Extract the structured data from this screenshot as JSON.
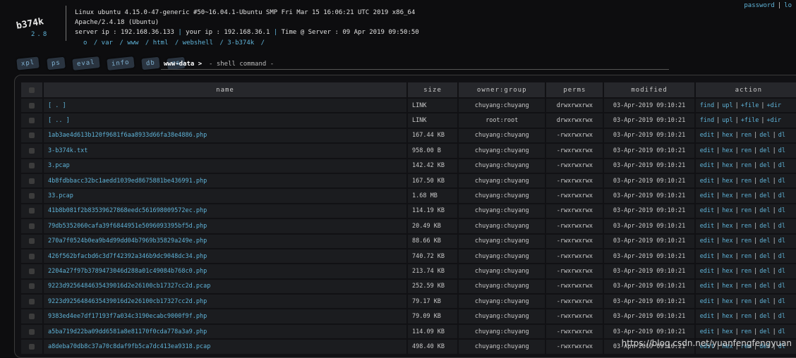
{
  "logo": {
    "name": "b374k",
    "version": "2.8"
  },
  "sysinfo": {
    "kernel": "Linux ubuntu 4.15.0-47-generic #50~16.04.1-Ubuntu SMP Fri Mar 15 16:06:21 UTC 2019 x86_64",
    "server_software": "Apache/2.4.18 (Ubuntu)",
    "server_ip": "server ip : 192.168.36.133",
    "your_ip": "your ip : 192.168.36.1",
    "time": "Time @ Server : 09 Apr 2019 09:50:50"
  },
  "path": [
    "o",
    "/ var",
    "/ www",
    "/ html",
    "/ webshell",
    "/ 3-b374k",
    "/"
  ],
  "top_links": {
    "password": "password",
    "logout": "lo"
  },
  "tabs": [
    "xpl",
    "ps",
    "eval",
    "info",
    "db",
    "rs"
  ],
  "user": "www-data >",
  "shell_label": "- shell command -",
  "columns": [
    "name",
    "size",
    "owner:group",
    "perms",
    "modified",
    "action"
  ],
  "files": [
    {
      "name": "[ . ]",
      "size": "LINK",
      "owner": "chuyang:chuyang",
      "perms": "drwxrwxrwx",
      "modified": "03-Apr-2019 09:10:21",
      "actions": [
        "find",
        "upl",
        "+file",
        "+dir"
      ]
    },
    {
      "name": "[ .. ]",
      "size": "LINK",
      "owner": "root:root",
      "perms": "drwxrwxrwx",
      "modified": "03-Apr-2019 09:10:21",
      "actions": [
        "find",
        "upl",
        "+file",
        "+dir"
      ]
    },
    {
      "name": "1ab3ae4d613b120f9681f6aa8933d66fa38e4886.php",
      "size": "167.44 KB",
      "owner": "chuyang:chuyang",
      "perms": "-rwxrwxrwx",
      "modified": "03-Apr-2019 09:10:21",
      "actions": [
        "edit",
        "hex",
        "ren",
        "del",
        "dl"
      ]
    },
    {
      "name": "3-b374k.txt",
      "size": "958.00 B",
      "owner": "chuyang:chuyang",
      "perms": "-rwxrwxrwx",
      "modified": "03-Apr-2019 09:10:21",
      "actions": [
        "edit",
        "hex",
        "ren",
        "del",
        "dl"
      ]
    },
    {
      "name": "3.pcap",
      "size": "142.42 KB",
      "owner": "chuyang:chuyang",
      "perms": "-rwxrwxrwx",
      "modified": "03-Apr-2019 09:10:21",
      "actions": [
        "edit",
        "hex",
        "ren",
        "del",
        "dl"
      ]
    },
    {
      "name": "4b8fdbbacc32bc1aedd1039ed8675881be436991.php",
      "size": "167.50 KB",
      "owner": "chuyang:chuyang",
      "perms": "-rwxrwxrwx",
      "modified": "03-Apr-2019 09:10:21",
      "actions": [
        "edit",
        "hex",
        "ren",
        "del",
        "dl"
      ]
    },
    {
      "name": "33.pcap",
      "size": "1.68 MB",
      "owner": "chuyang:chuyang",
      "perms": "-rwxrwxrwx",
      "modified": "03-Apr-2019 09:10:21",
      "actions": [
        "edit",
        "hex",
        "ren",
        "del",
        "dl"
      ]
    },
    {
      "name": "41b8b081f2b83539627868eedc561698009572ec.php",
      "size": "114.19 KB",
      "owner": "chuyang:chuyang",
      "perms": "-rwxrwxrwx",
      "modified": "03-Apr-2019 09:10:21",
      "actions": [
        "edit",
        "hex",
        "ren",
        "del",
        "dl"
      ]
    },
    {
      "name": "79db5352060cafa39f6844951e5096093395bf5d.php",
      "size": "20.49 KB",
      "owner": "chuyang:chuyang",
      "perms": "-rwxrwxrwx",
      "modified": "03-Apr-2019 09:10:21",
      "actions": [
        "edit",
        "hex",
        "ren",
        "del",
        "dl"
      ]
    },
    {
      "name": "270a7f0524b0ea9b4d99dd04b7969b35829a249e.php",
      "size": "88.66 KB",
      "owner": "chuyang:chuyang",
      "perms": "-rwxrwxrwx",
      "modified": "03-Apr-2019 09:10:21",
      "actions": [
        "edit",
        "hex",
        "ren",
        "del",
        "dl"
      ]
    },
    {
      "name": "426f562bfacbd6c3d7f42392a346b9dc9048dc34.php",
      "size": "740.72 KB",
      "owner": "chuyang:chuyang",
      "perms": "-rwxrwxrwx",
      "modified": "03-Apr-2019 09:10:21",
      "actions": [
        "edit",
        "hex",
        "ren",
        "del",
        "dl"
      ]
    },
    {
      "name": "2204a27f97b3789473046d288a01c49084b768c0.php",
      "size": "213.74 KB",
      "owner": "chuyang:chuyang",
      "perms": "-rwxrwxrwx",
      "modified": "03-Apr-2019 09:10:21",
      "actions": [
        "edit",
        "hex",
        "ren",
        "del",
        "dl"
      ]
    },
    {
      "name": "9223d9256484635439016d2e26100cb17327cc2d.pcap",
      "size": "252.59 KB",
      "owner": "chuyang:chuyang",
      "perms": "-rwxrwxrwx",
      "modified": "03-Apr-2019 09:10:21",
      "actions": [
        "edit",
        "hex",
        "ren",
        "del",
        "dl"
      ]
    },
    {
      "name": "9223d9256484635439016d2e26100cb17327cc2d.php",
      "size": "79.17 KB",
      "owner": "chuyang:chuyang",
      "perms": "-rwxrwxrwx",
      "modified": "03-Apr-2019 09:10:21",
      "actions": [
        "edit",
        "hex",
        "ren",
        "del",
        "dl"
      ]
    },
    {
      "name": "9383ed4ee7df17193f7a034c3190ecabc9000f9f.php",
      "size": "79.09 KB",
      "owner": "chuyang:chuyang",
      "perms": "-rwxrwxrwx",
      "modified": "03-Apr-2019 09:10:21",
      "actions": [
        "edit",
        "hex",
        "ren",
        "del",
        "dl"
      ]
    },
    {
      "name": "a5ba719d22ba09dd6581a8e81170f0cda778a3a9.php",
      "size": "114.09 KB",
      "owner": "chuyang:chuyang",
      "perms": "-rwxrwxrwx",
      "modified": "03-Apr-2019 09:10:21",
      "actions": [
        "edit",
        "hex",
        "ren",
        "del",
        "dl"
      ]
    },
    {
      "name": "a8deba70db8c37a70c8daf9fb5ca7dc413ea9318.pcap",
      "size": "498.40 KB",
      "owner": "chuyang:chuyang",
      "perms": "-rwxrwxrwx",
      "modified": "03-Apr-2019 09:10:21",
      "actions": [
        "edit",
        "hex",
        "ren",
        "del",
        "dl"
      ]
    }
  ],
  "watermark": "https://blog.csdn.net/yuanfengfengyuan",
  "colors": {
    "accent": "#5fb3d8",
    "background": "#0d0d0f"
  }
}
